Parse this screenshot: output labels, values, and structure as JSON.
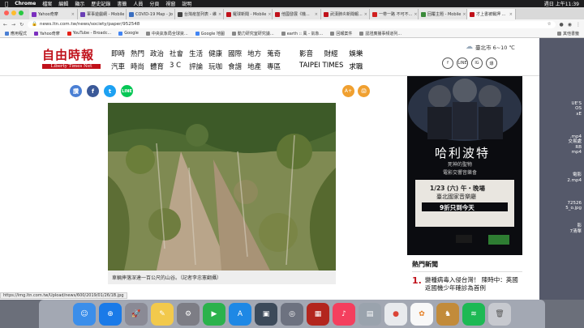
{
  "menubar": {
    "app": "Chrome",
    "items": [
      "檔案",
      "編輯",
      "顯示",
      "歷史記錄",
      "書籤",
      "人員",
      "分頁",
      "視窗",
      "說明"
    ],
    "clock": "週日 上午11:39"
  },
  "tabs": [
    {
      "label": "Yahoo奇摩",
      "color": "#7b2fbe"
    },
    {
      "label": "軍事遊戲網 - Mobile",
      "color": "#6a3fb5"
    },
    {
      "label": "COVID-19 Map - Jo",
      "color": "#3a6ec0"
    },
    {
      "label": "台灣疫苗列表 - 維",
      "color": "#444444"
    },
    {
      "label": "羅球新聞 - Mobile",
      "color": "#c0111a"
    },
    {
      "label": "他國發展《機...",
      "color": "#c0111a"
    },
    {
      "label": "武漢肺炎新聞報...",
      "color": "#c0111a"
    },
    {
      "label": "一帶一路 不可不...",
      "color": "#d02020"
    },
    {
      "label": "回覆主題 - Mobile",
      "color": "#3a8a3a"
    },
    {
      "label": "才上書被羈押 ...",
      "color": "#c0111a"
    }
  ],
  "address": {
    "url": "news.ltn.com.tw/news/society/paper/952548"
  },
  "bookmarks": [
    {
      "label": "應用程式"
    },
    {
      "label": "Yahoo奇摩"
    },
    {
      "label": "YouTube - Broadc..."
    },
    {
      "label": "Google"
    },
    {
      "label": "中央氣象局全球資..."
    },
    {
      "label": "Google 地圖"
    },
    {
      "label": "動力研究室研究議..."
    },
    {
      "label": "earth :: 風 - 氣象..."
    },
    {
      "label": "回報案件"
    },
    {
      "label": "認證廣播事頻道列..."
    }
  ],
  "bookmarks_other": "其他書籤",
  "site": {
    "logo_cn": "自由時報",
    "logo_en": "Liberty Times Net",
    "nav": [
      "即時",
      "熱門",
      "政治",
      "社會",
      "生活",
      "健康",
      "國際",
      "地方",
      "蒐奇",
      "影音",
      "財經",
      "娛樂",
      "汽車",
      "時尚",
      "體育",
      "3 C",
      "評論",
      "玩咖",
      "食譜",
      "地產",
      "專區",
      "TAIPEI TIMES",
      "求職"
    ],
    "weather": "臺北市 6~10 ℃",
    "socials": [
      "f",
      "LINE",
      "IG",
      "爆"
    ]
  },
  "share": [
    {
      "label": "讚",
      "color": "#4a7fd4"
    },
    {
      "label": "f",
      "color": "#3b5998"
    },
    {
      "label": "t",
      "color": "#1da1f2"
    },
    {
      "label": "LINE",
      "color": "#06c755"
    }
  ],
  "fontbtns": [
    "A+",
    "🖨"
  ],
  "caption": "車輛摔落深達一百公尺的山谷。（記者李忠憲翻攝）",
  "ad": {
    "title": "哈利波特",
    "subtitle": "死神的聖物",
    "sub2": "電影交響音樂會",
    "date": "1/23 (六) 午・晚場",
    "venue": "臺北國家音樂廳",
    "promo": "9折只到今天"
  },
  "hot": {
    "title": "熱門新聞",
    "items": [
      {
        "num": "1.",
        "text": "變種病毒入侵台灣！ 陳時中：英國返國機少年確診為首例"
      }
    ]
  },
  "status": "https://img.ltn.com.tw/Upload/news/600/2019/01/26/1B.jpg",
  "desktop": [
    "UE'S",
    "OS",
    "xE",
    ".mp4",
    "交易處",
    "RB",
    "mp4",
    "電影",
    "2.mp4",
    "72526",
    "5_o.jpg",
    "影",
    "7清單"
  ]
}
